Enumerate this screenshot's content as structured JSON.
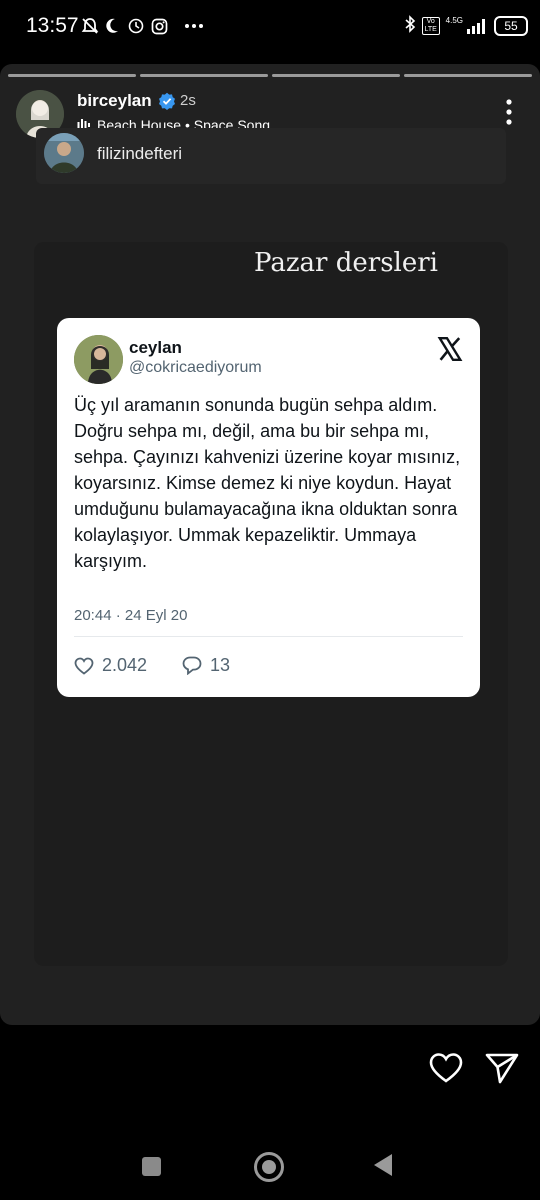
{
  "status_bar": {
    "time": "13:57",
    "battery": "55",
    "network": "4.5G",
    "volte": "Vo LTE"
  },
  "story": {
    "progress_segments": 4,
    "username": "birceylan",
    "posted_ago": "2s",
    "music": {
      "artist": "Beach House",
      "separator": " • ",
      "song": "Space Song"
    },
    "mention": "filizindefteri",
    "overlay_text": "Pazar dersleri"
  },
  "tweet": {
    "name": "ceylan",
    "handle": "@cokricaediyorum",
    "text": "Üç yıl aramanın sonunda bugün sehpa aldım. Doğru sehpa mı, değil, ama bu bir sehpa mı, sehpa. Çayınızı kahvenizi üzerine koyar mısınız, koyarsınız. Kimse demez ki niye koydun. Hayat umduğunu bulamayacağına ikna olduktan sonra kolaylaşıyor. Ummak kepazeliktir. Ummaya karşıyım.",
    "date": "20:44 · 24 Eyl 20",
    "likes": "2.042",
    "replies": "13"
  },
  "colors": {
    "story_bg": "#212121",
    "tweet_bg": "#ffffff",
    "tweet_text": "#0f1419",
    "tweet_secondary": "#536471",
    "verified": "#3897f0"
  }
}
